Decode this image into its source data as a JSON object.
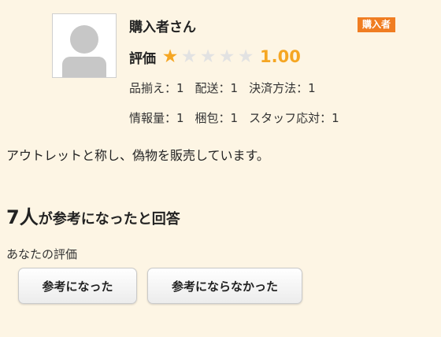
{
  "review": {
    "reviewer_name": "購入者さん",
    "badge": "購入者",
    "rating_label": "評価",
    "rating_value": "1.00",
    "stars_filled": 1,
    "stars_total": 5,
    "star_color_filled": "#f5a623",
    "star_color_empty": "#e2e2e2",
    "subscores_row1": [
      {
        "label": "品揃え：1"
      },
      {
        "label": "配送：1"
      },
      {
        "label": "決済方法：1"
      }
    ],
    "subscores_row2": [
      {
        "label": "情報量：1"
      },
      {
        "label": "梱包：1"
      },
      {
        "label": "スタッフ応対：1"
      }
    ],
    "text": "アウトレットと称し、偽物を販売しています。"
  },
  "helpful": {
    "count": "7人",
    "suffix": "が参考になったと回答",
    "your_rating_label": "あなたの評価",
    "helpful_button": "参考になった",
    "not_helpful_button": "参考にならなかった"
  },
  "colors": {
    "background": "#fdf5e4",
    "badge": "#f07d22"
  }
}
